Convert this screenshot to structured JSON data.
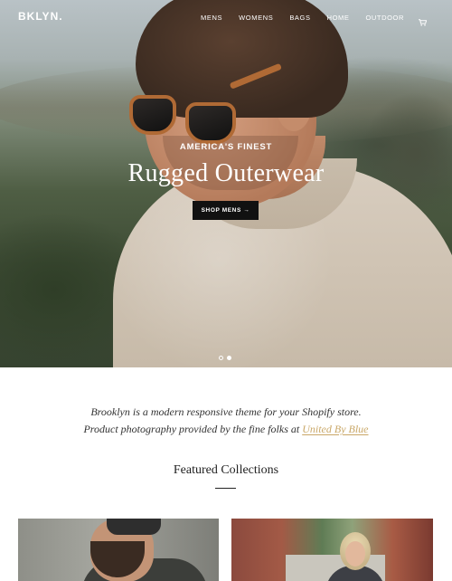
{
  "brand": {
    "logo": "BKLYN."
  },
  "nav": {
    "items": [
      "MENS",
      "WOMENS",
      "BAGS",
      "HOME",
      "OUTDOOR"
    ],
    "cart_icon": "cart-icon"
  },
  "hero": {
    "eyebrow": "AMERICA'S FINEST",
    "title": "Rugged Outerwear",
    "button_label": "SHOP MENS →",
    "slides": 2,
    "active_slide": 2
  },
  "intro": {
    "line1": "Brooklyn is a modern responsive theme for your Shopify store.",
    "line2_prefix": "Product photography provided by the fine folks at ",
    "link_text": "United By Blue",
    "link_color": "#c9a767"
  },
  "featured": {
    "title": "Featured Collections"
  },
  "colors": {
    "text": "#333333",
    "button_bg": "#111111",
    "accent_link": "#c9a767"
  }
}
